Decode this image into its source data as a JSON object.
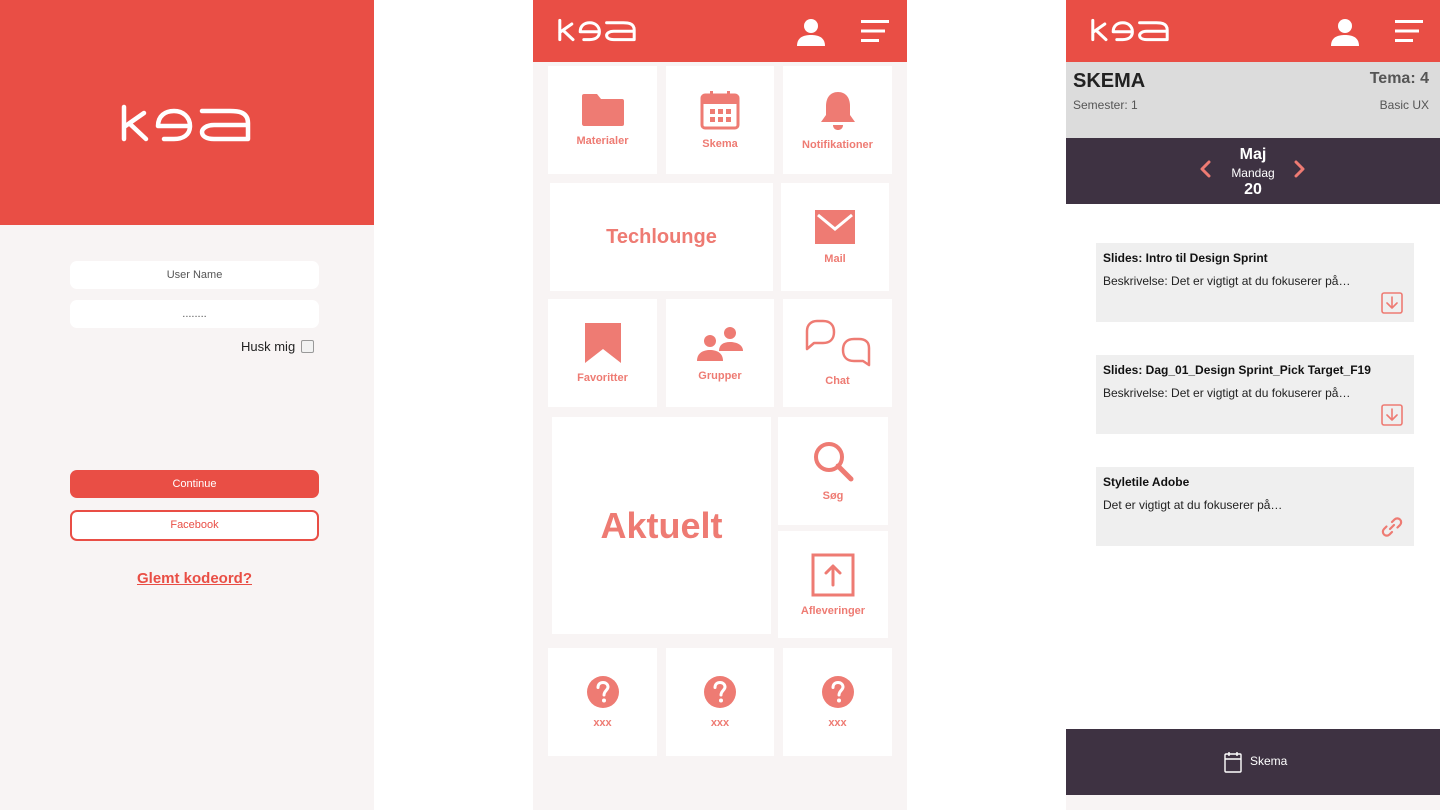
{
  "brand": {
    "logo_text": "kea",
    "primary": "#e94e45",
    "accent_soft": "#ee7b73",
    "dark": "#3e3242"
  },
  "login": {
    "username_placeholder": "User Name",
    "password_value": "........",
    "remember_label": "Husk mig",
    "continue_label": "Continue",
    "facebook_label": "Facebook",
    "forgot_label": "Glemt kodeord?"
  },
  "dashboard": {
    "tiles": {
      "materialer": {
        "label": "Materialer",
        "icon": "folder-icon"
      },
      "skema": {
        "label": "Skema",
        "icon": "calendar-icon"
      },
      "notifikationer": {
        "label": "Notifikationer",
        "icon": "bell-icon"
      },
      "techlounge": {
        "label": "Techlounge"
      },
      "mail": {
        "label": "Mail",
        "icon": "mail-icon"
      },
      "favoritter": {
        "label": "Favoritter",
        "icon": "bookmark-icon"
      },
      "grupper": {
        "label": "Grupper",
        "icon": "group-icon"
      },
      "chat": {
        "label": "Chat",
        "icon": "chat-icon"
      },
      "aktuelt": {
        "label": "Aktuelt"
      },
      "soeg": {
        "label": "Søg",
        "icon": "search-icon"
      },
      "afleveringer": {
        "label": "Afleveringer",
        "icon": "upload-icon"
      },
      "xxx1": {
        "label": "xxx",
        "icon": "question-icon"
      },
      "xxx2": {
        "label": "xxx",
        "icon": "question-icon"
      },
      "xxx3": {
        "label": "xxx",
        "icon": "question-icon"
      }
    }
  },
  "schedule": {
    "title": "SKEMA",
    "semester": "Semester: 1",
    "tema": "Tema: 4",
    "course": "Basic UX",
    "month": "Maj",
    "weekday": "Mandag",
    "day": "20",
    "items": [
      {
        "title": "Slides: Intro til Design Sprint",
        "desc": "Beskrivelse: Det er vigtigt at du fokuserer på…",
        "icon": "download-icon"
      },
      {
        "title": "Slides: Dag_01_Design Sprint_Pick Target_F19",
        "desc": "Beskrivelse: Det er vigtigt at du fokuserer på…",
        "icon": "download-icon"
      },
      {
        "title": "Styletile Adobe",
        "desc": "Det er vigtigt at du fokuserer på…",
        "icon": "link-icon"
      }
    ],
    "bottom_label": "Skema"
  }
}
